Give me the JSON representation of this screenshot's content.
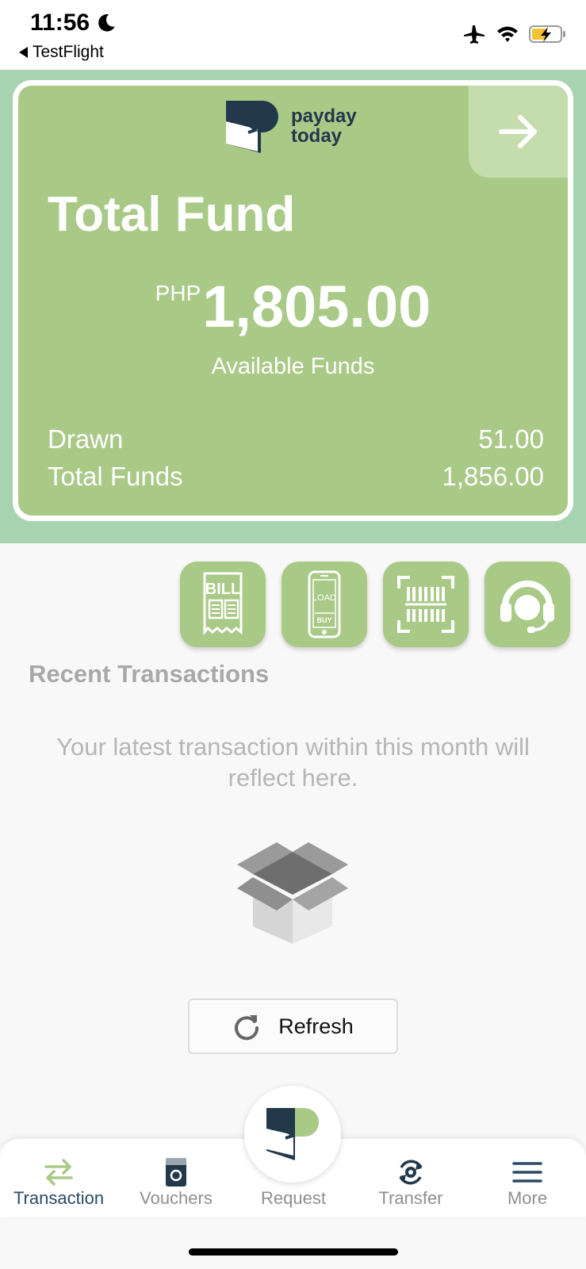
{
  "status_bar": {
    "time": "11:56",
    "back_app": "TestFlight"
  },
  "card": {
    "logo_line1": "payday",
    "logo_line2": "today",
    "title": "Total Fund",
    "currency": "PHP",
    "amount": "1,805.00",
    "amount_caption": "Available Funds",
    "drawn_label": "Drawn",
    "drawn_value": "51.00",
    "total_label": "Total Funds",
    "total_value": "1,856.00"
  },
  "quick_actions": [
    {
      "icon": "bill-icon",
      "text": "BILL"
    },
    {
      "icon": "load-buy-icon",
      "text_top": "LOAD",
      "text_bottom": "BUY"
    },
    {
      "icon": "barcode-scan-icon"
    },
    {
      "icon": "support-headset-icon"
    }
  ],
  "recent": {
    "title": "Recent Transactions",
    "empty_message": "Your latest transaction within this month will reflect here.",
    "refresh_label": "Refresh"
  },
  "nav": {
    "items": [
      {
        "label": "Transaction",
        "icon": "transfer-arrows-icon",
        "active": true
      },
      {
        "label": "Vouchers",
        "icon": "voucher-icon",
        "active": false
      },
      {
        "label": "Request",
        "icon": "payday-logo-icon",
        "active": false
      },
      {
        "label": "Transfer",
        "icon": "transfer-cycle-icon",
        "active": false
      },
      {
        "label": "More",
        "icon": "hamburger-menu-icon",
        "active": false
      }
    ]
  },
  "colors": {
    "card_green": "#a9c987",
    "band_green": "#a8d3b0",
    "navy": "#22384b",
    "active_nav": "#2a4a63",
    "inactive_nav": "#8f8f8f"
  }
}
